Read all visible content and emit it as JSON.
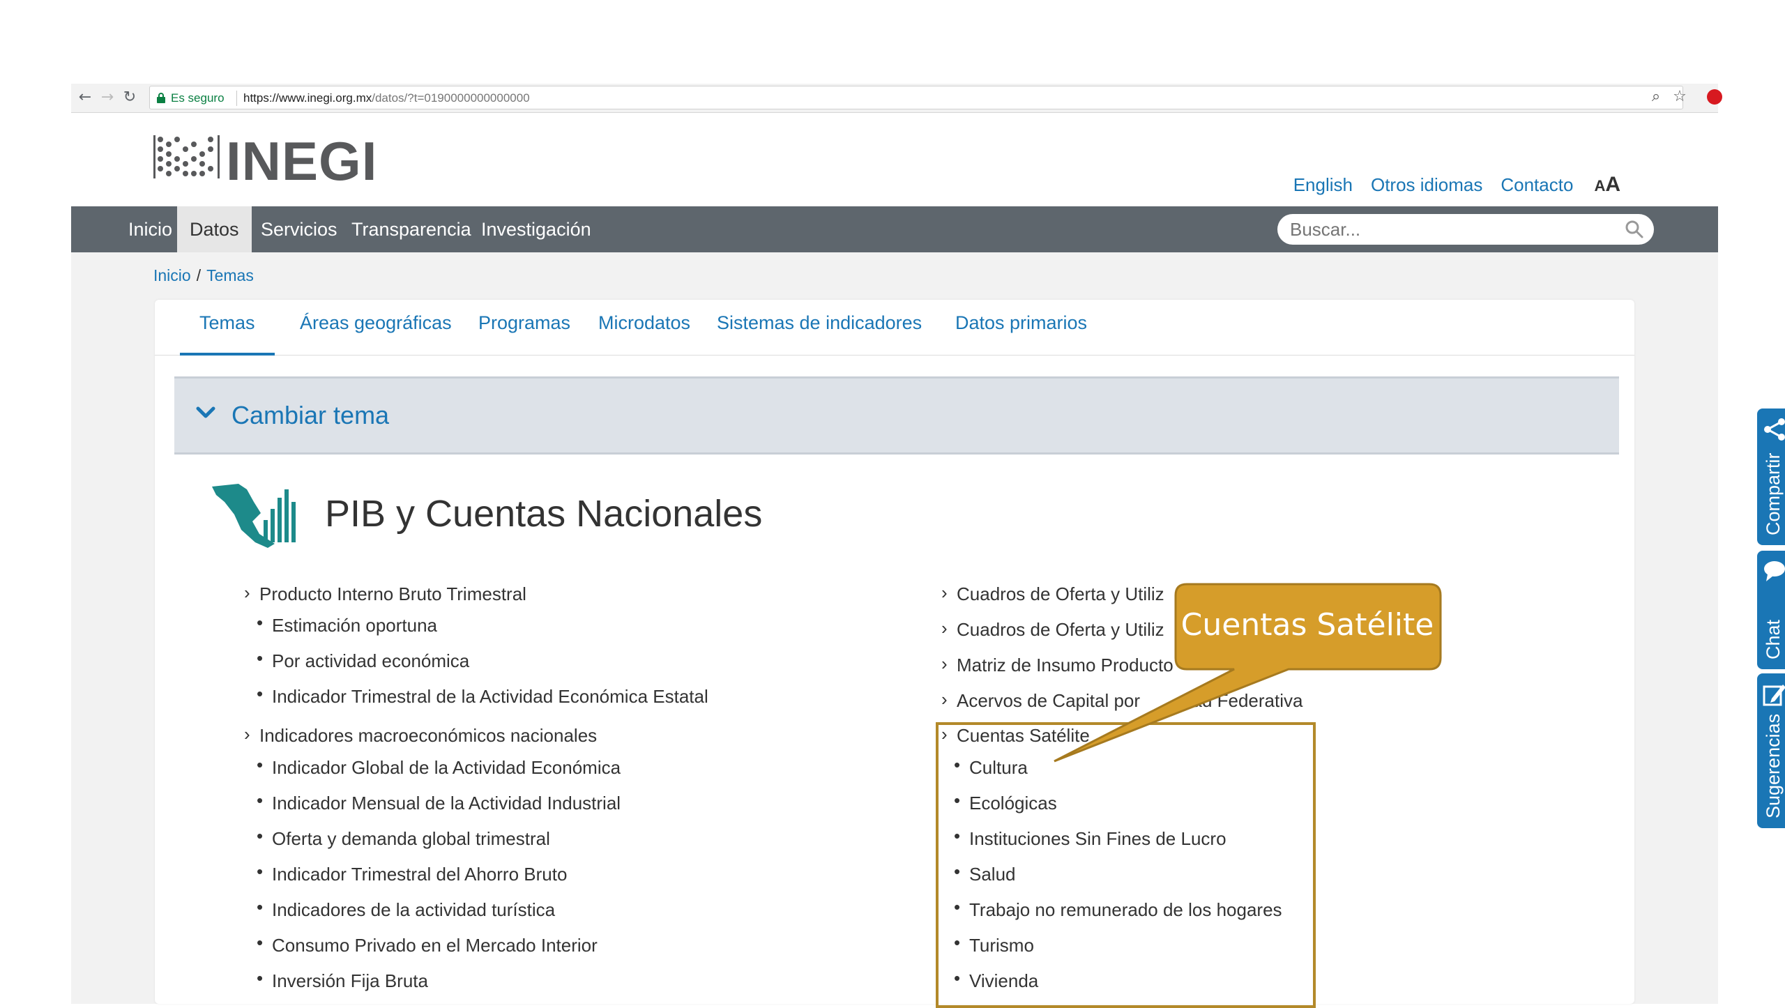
{
  "browser": {
    "secure_label": "Es seguro",
    "url_host": "https://www.inegi.org.mx",
    "url_rest": "/datos/?t=0190000000000000"
  },
  "header": {
    "logo_text": "INEGI",
    "top_links": [
      "English",
      "Otros idiomas",
      "Contacto"
    ],
    "font_size_toggle": "AA"
  },
  "mainnav": {
    "items": [
      "Inicio",
      "Datos",
      "Servicios",
      "Transparencia",
      "Investigación"
    ],
    "active": "Datos",
    "search_placeholder": "Buscar..."
  },
  "breadcrumb": [
    "Inicio",
    "Temas"
  ],
  "tabs": [
    "Temas",
    "Áreas geográficas",
    "Programas",
    "Microdatos",
    "Sistemas de indicadores",
    "Datos primarios"
  ],
  "cambiar_tema": "Cambiar tema",
  "topic_title": "PIB y Cuentas Nacionales",
  "left_column": [
    {
      "title": "Producto Interno Bruto Trimestral",
      "items": [
        "Estimación oportuna",
        "Por actividad económica",
        "Indicador Trimestral de la Actividad Económica Estatal"
      ]
    },
    {
      "title": "Indicadores macroeconómicos nacionales",
      "items": [
        "Indicador Global de la Actividad Económica",
        "Indicador Mensual de la Actividad Industrial",
        "Oferta y demanda global trimestral",
        "Indicador Trimestral del Ahorro Bruto",
        "Indicadores de la actividad turística",
        "Consumo Privado en el Mercado Interior",
        "Inversión Fija Bruta"
      ]
    }
  ],
  "right_column": {
    "links": [
      "Cuadros de Oferta y Utiliz",
      "Cuadros de Oferta y Utiliz",
      "Matriz de Insumo Producto",
      "Acervos de Capital por",
      "dad Federativa"
    ],
    "satelite_title": "Cuentas Satélite",
    "satelite_items": [
      "Cultura",
      "Ecológicas",
      "Instituciones Sin Fines de Lucro",
      "Salud",
      "Trabajo no remunerado de los hogares",
      "Turismo",
      "Vivienda"
    ]
  },
  "callout": {
    "text": "Cuentas Satélite",
    "fill": "#d69d2a",
    "border": "#a67a1f"
  },
  "side_widgets": [
    "Compartir",
    "Chat",
    "Sugerencias"
  ],
  "colors": {
    "link": "#1a76b5",
    "nav_bg": "#5e666d",
    "accent_box": "#b3892a"
  }
}
